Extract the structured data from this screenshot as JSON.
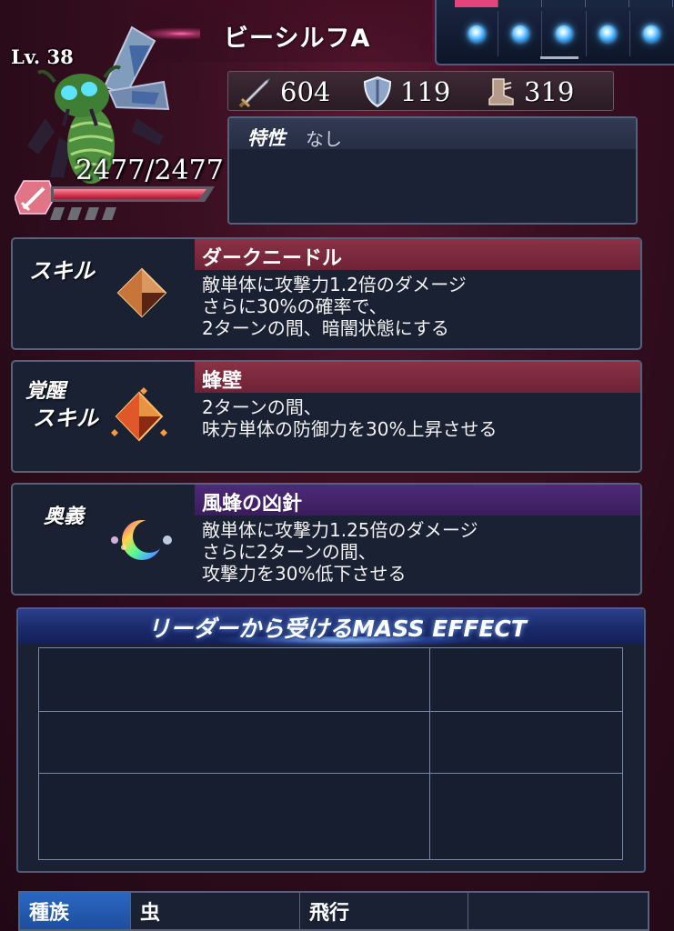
{
  "unit": {
    "name": "ビーシルフA",
    "level": "Lv. 38",
    "hp": "2477/2477",
    "hp_fraction": 1.0
  },
  "orb_tabs": {
    "active_index": 0,
    "count": 5
  },
  "orbs": [
    "orb-blue",
    "orb-blue",
    "orb-blue",
    "orb-blue",
    "orb-blue"
  ],
  "stats": {
    "attack": "604",
    "defense": "119",
    "speed": "319",
    "attack_icon": "sword-icon",
    "defense_icon": "shield-icon",
    "speed_icon": "boot-icon"
  },
  "trait": {
    "label": "特性",
    "value": "なし"
  },
  "skill": {
    "category": "スキル",
    "name": "ダークニードル",
    "description": [
      "敵単体に攻撃力1.2倍のダメージ",
      "さらに30%の確率で、",
      "2ターンの間、暗闇状態にする"
    ],
    "icon": "crystal-icon"
  },
  "awakened_skill": {
    "category_line1": "覚醒",
    "category_line2": "スキル",
    "name": "蜂壁",
    "description": [
      "2ターンの間、",
      "味方単体の防御力を30%上昇させる"
    ],
    "icon": "awakened-crystal-icon"
  },
  "ultimate": {
    "category": "奥義",
    "name": "風蜂の凶針",
    "description": [
      "敵単体に攻撃力1.25倍のダメージ",
      "さらに2ターンの間、",
      "攻撃力を30%低下させる"
    ],
    "icon": "crescent-orb-icon"
  },
  "mass_effect": {
    "title": "リーダーから受けるMASS EFFECT",
    "rows": [
      [
        "",
        ""
      ],
      [
        "",
        ""
      ],
      [
        "",
        ""
      ]
    ]
  },
  "footer": {
    "label": "種族",
    "race": "虫",
    "attribute": "飛行",
    "extra": ""
  },
  "colors": {
    "hp_bar": "#d43451",
    "skill_bar": "#8a3145",
    "ultimate_bar": "#4e2a78",
    "race_label_bg": "#2a67c2",
    "orb": "#3aa8ff"
  }
}
